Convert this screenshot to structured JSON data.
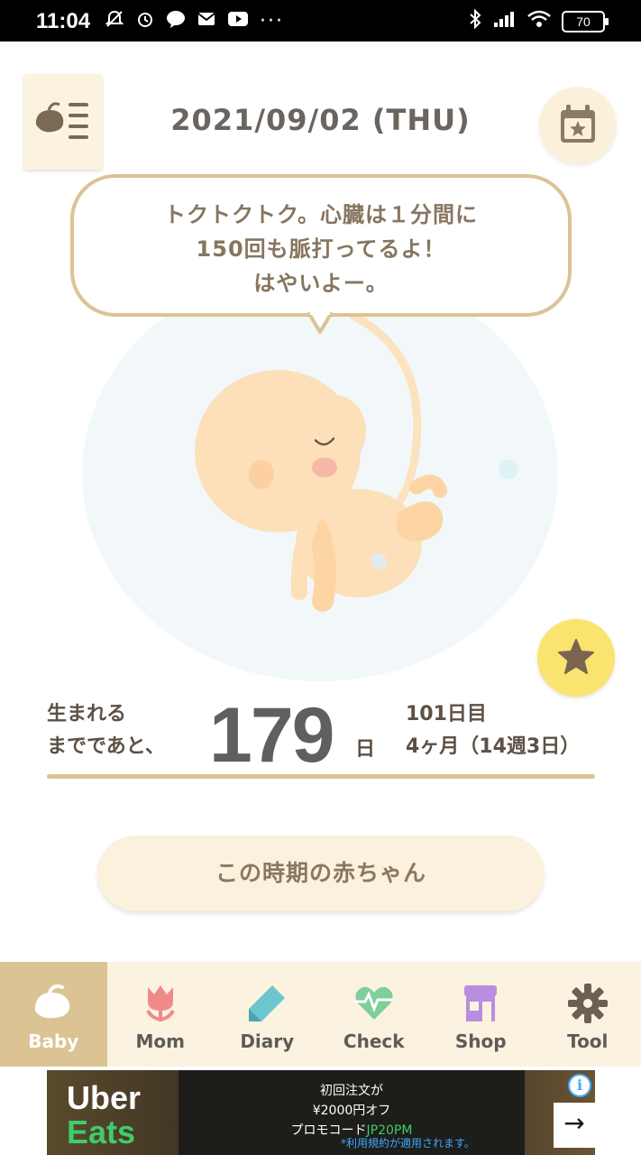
{
  "status_bar": {
    "time": "11:04",
    "battery": "70",
    "icons": [
      "mute-icon",
      "alarm-icon",
      "line-icon",
      "mail-icon",
      "youtube-icon",
      "more-icon",
      "bluetooth-icon",
      "signal-icon",
      "wifi-icon"
    ]
  },
  "header": {
    "date": "2021/09/02 (THU)"
  },
  "bubble": {
    "lines": [
      "トクトクトク。心臓は１分間に",
      "150回も脈打ってるよ！",
      "はやいよー。"
    ]
  },
  "countdown": {
    "label_line1": "生まれる",
    "label_line2": "までであと、",
    "days": "179",
    "unit": "日",
    "day_count": "101日目",
    "month_week": "4ヶ月（14週3日）"
  },
  "period_button": {
    "label": "この時期の赤ちゃん"
  },
  "nav": {
    "items": [
      {
        "label": "Baby",
        "icon": "bird-icon",
        "active": true
      },
      {
        "label": "Mom",
        "icon": "tulip-icon",
        "active": false
      },
      {
        "label": "Diary",
        "icon": "pen-icon",
        "active": false
      },
      {
        "label": "Check",
        "icon": "heart-pulse-icon",
        "active": false
      },
      {
        "label": "Shop",
        "icon": "store-icon",
        "active": false
      },
      {
        "label": "Tool",
        "icon": "gear-icon",
        "active": false
      }
    ]
  },
  "ad": {
    "brand_line1": "Uber",
    "brand_line2": "Eats",
    "line1": "初回注文が",
    "line2": "¥2000円オフ",
    "line3_prefix": "プロモコード",
    "promo_code": "JP20PM",
    "note": "*利用規約が適用されます。",
    "info": "i",
    "arrow": "→"
  },
  "colors": {
    "accent_tan": "#dcc394",
    "cream": "#fbf3e0",
    "star_yellow": "#fbe36f",
    "text_brown": "#5d5045"
  }
}
